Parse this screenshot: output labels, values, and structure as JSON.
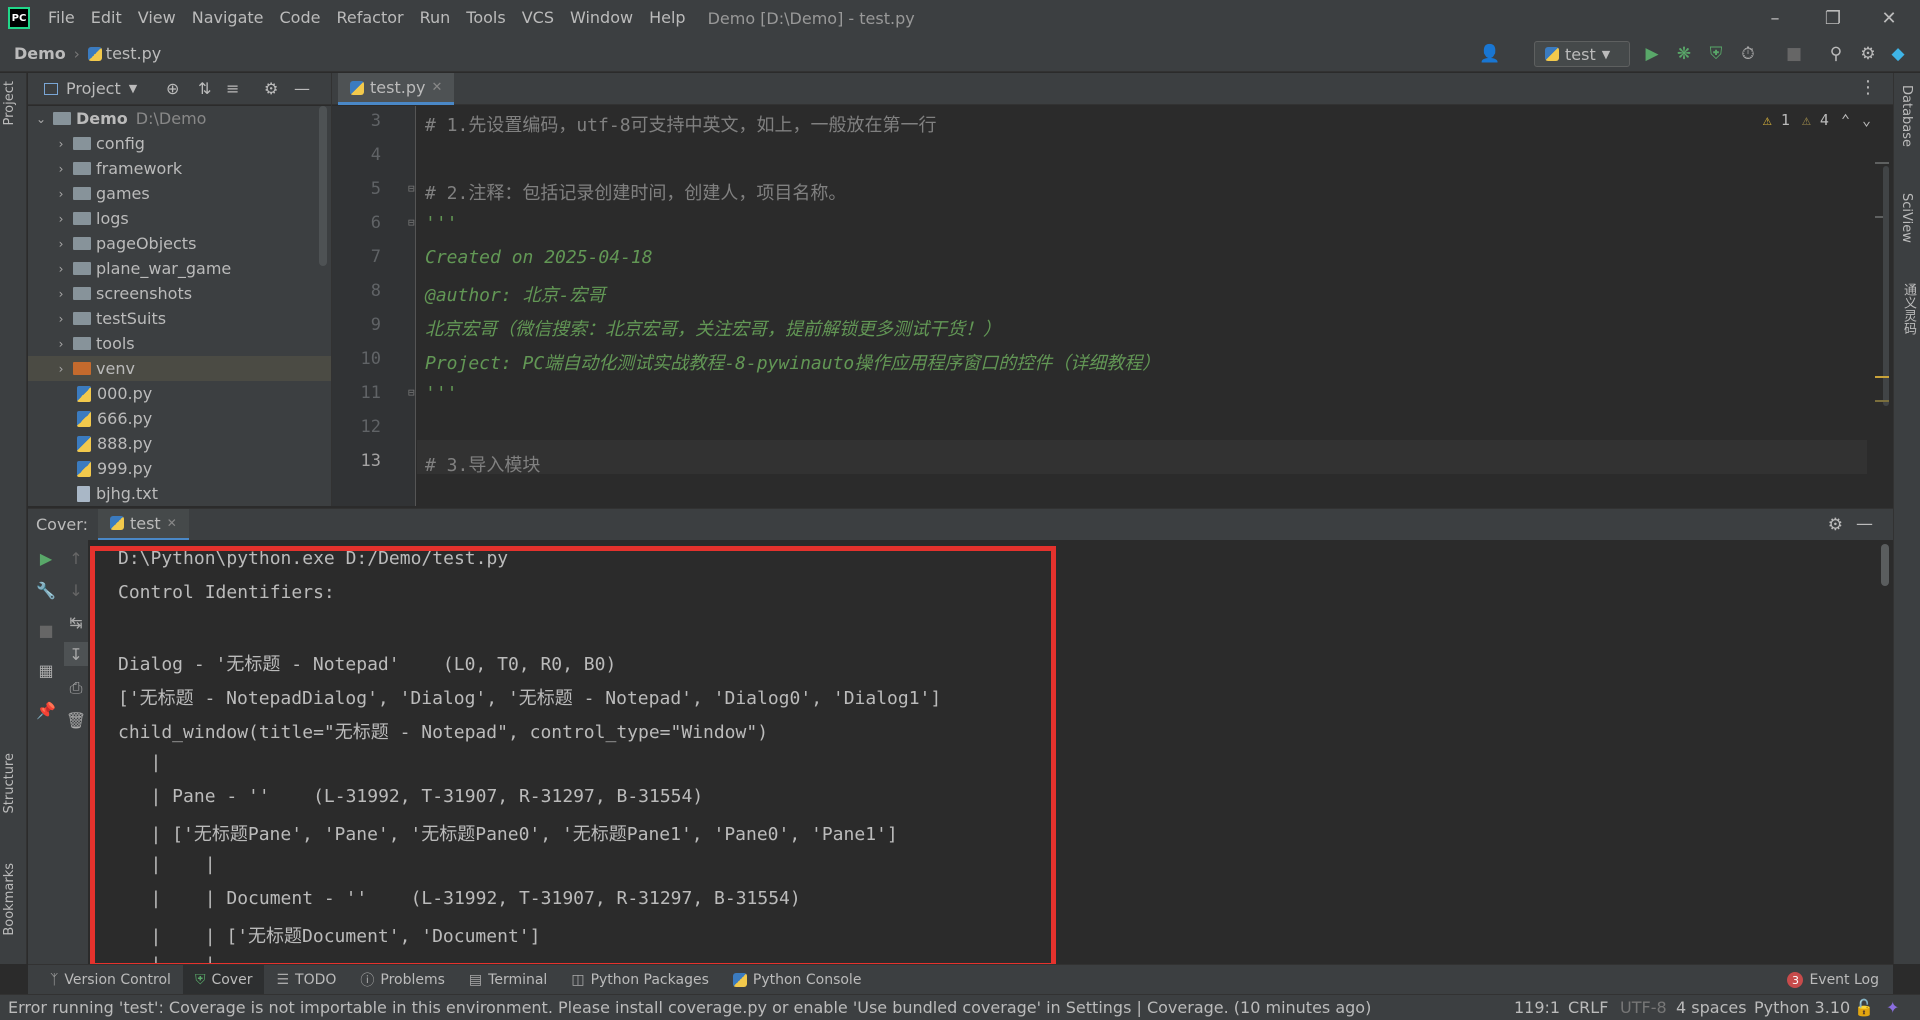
{
  "app": {
    "logo_text": "PC",
    "window_title": "Demo [D:\\Demo] - test.py",
    "menu": [
      "File",
      "Edit",
      "View",
      "Navigate",
      "Code",
      "Refactor",
      "Run",
      "Tools",
      "VCS",
      "Window",
      "Help"
    ]
  },
  "breadcrumb": {
    "project": "Demo",
    "file": "test.py"
  },
  "run_config": {
    "name": "test"
  },
  "project_panel": {
    "title": "Project",
    "tree": [
      {
        "name": "Demo",
        "path": "D:\\Demo"
      },
      {
        "name": "config"
      },
      {
        "name": "framework"
      },
      {
        "name": "games"
      },
      {
        "name": "logs"
      },
      {
        "name": "pageObjects"
      },
      {
        "name": "plane_war_game"
      },
      {
        "name": "screenshots"
      },
      {
        "name": "testSuits"
      },
      {
        "name": "tools"
      },
      {
        "name": "venv"
      },
      {
        "name": "000.py"
      },
      {
        "name": "666.py"
      },
      {
        "name": "888.py"
      },
      {
        "name": "999.py"
      },
      {
        "name": "bjhg.txt"
      }
    ]
  },
  "editor": {
    "tab": "test.py",
    "inspections": {
      "warnings": "1",
      "weak_warnings": "4"
    },
    "line_numbers": [
      "3",
      "4",
      "5",
      "6",
      "7",
      "8",
      "9",
      "10",
      "11",
      "12",
      "13"
    ],
    "lines": [
      "# 1.先设置编码，utf-8可支持中英文，如上，一般放在第一行",
      "",
      "# 2.注释：包括记录创建时间，创建人，项目名称。",
      "'''",
      "Created on 2025-04-18",
      "@author: 北京-宏哥",
      "北京宏哥（微信搜索：北京宏哥，关注宏哥，提前解锁更多测试干货！）",
      "Project: PC端自动化测试实战教程-8-pywinauto操作应用程序窗口的控件（详细教程）",
      "'''",
      "",
      "# 3.导入模块"
    ]
  },
  "run_window": {
    "title": "Cover:",
    "tab": "test",
    "output": [
      "D:\\Python\\python.exe D:/Demo/test.py",
      "Control Identifiers:",
      "",
      "Dialog - '无标题 - Notepad'    (L0, T0, R0, B0)",
      "['无标题 - NotepadDialog', 'Dialog', '无标题 - Notepad', 'Dialog0', 'Dialog1']",
      "child_window(title=\"无标题 - Notepad\", control_type=\"Window\")",
      "   |",
      "   | Pane - ''    (L-31992, T-31907, R-31297, B-31554)",
      "   | ['无标题Pane', 'Pane', '无标题Pane0', '无标题Pane1', 'Pane0', 'Pane1']",
      "   |    |",
      "   |    | Document - ''    (L-31992, T-31907, R-31297, B-31554)",
      "   |    | ['无标题Document', 'Document']",
      "   |    |"
    ]
  },
  "tool_tabs": [
    "Version Control",
    "Cover",
    "TODO",
    "Problems",
    "Terminal",
    "Python Packages",
    "Python Console"
  ],
  "event_log": {
    "label": "Event Log",
    "count": "3"
  },
  "side_tabs": {
    "left_top": "Project",
    "left_mid": "Structure",
    "left_bottom": "Bookmarks",
    "right": [
      "Database",
      "SciView",
      "通义灵码"
    ]
  },
  "status_bar": {
    "message": "Error running 'test': Coverage is not importable in this environment. Please install coverage.py or enable 'Use bundled coverage' in Settings | Coverage. (10 minutes ago)",
    "position": "119:1",
    "line_sep": "CRLF",
    "encoding": "UTF-8",
    "indent": "4 spaces",
    "interpreter": "Python 3.10"
  }
}
